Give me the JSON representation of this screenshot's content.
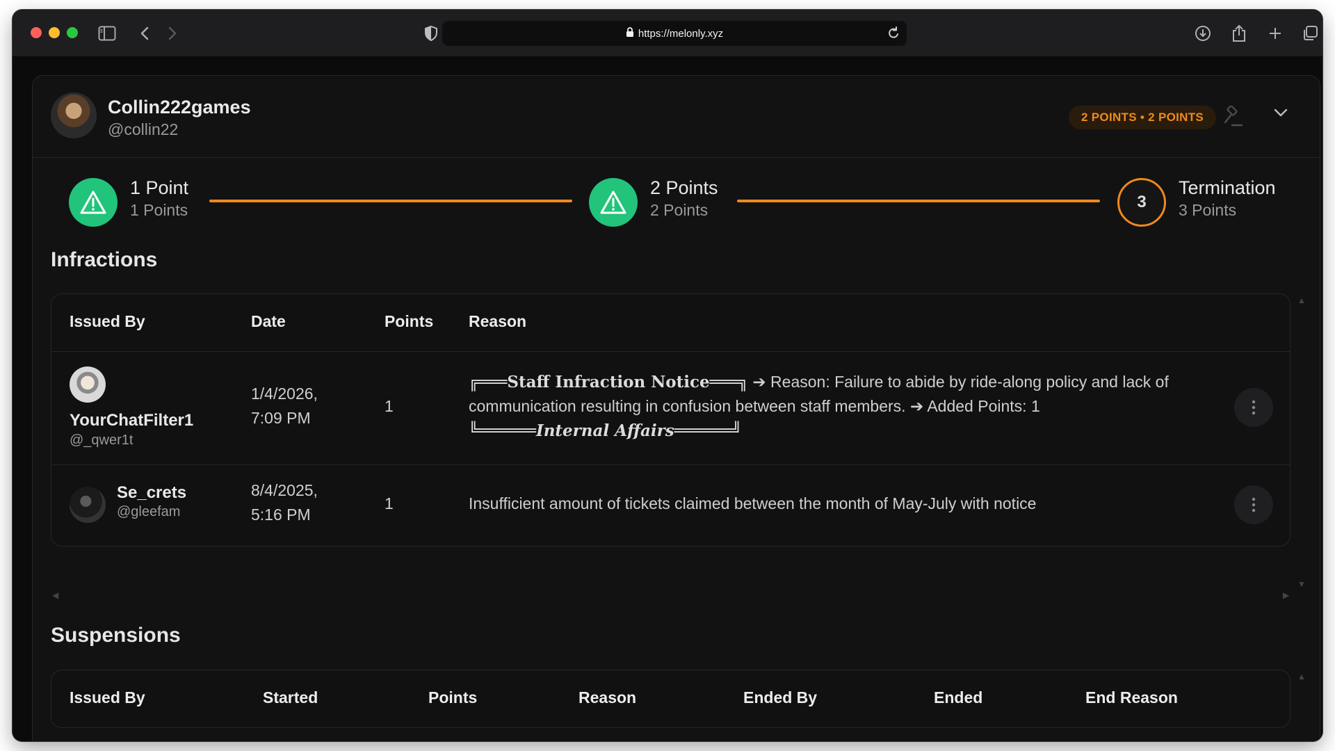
{
  "browser": {
    "url": "https://melonly.xyz"
  },
  "profile": {
    "display_name": "Collin222games",
    "handle": "@collin22",
    "points_badge": "2 POINTS • 2 POINTS"
  },
  "progress": {
    "steps": [
      {
        "title": "1 Point",
        "sub": "1 Points",
        "state": "reached",
        "icon": "warning-icon"
      },
      {
        "title": "2 Points",
        "sub": "2 Points",
        "state": "reached",
        "icon": "warning-icon"
      },
      {
        "title": "Termination",
        "sub": "3 Points",
        "state": "pending",
        "number": "3"
      }
    ]
  },
  "infractions": {
    "title": "Infractions",
    "headers": [
      "Issued By",
      "Date",
      "Points",
      "Reason"
    ],
    "rows": [
      {
        "issuer_name": "YourChatFilter1",
        "issuer_handle": "@_qwer1t",
        "date_line1": "1/4/2026,",
        "date_line2": "7:09 PM",
        "points": "1",
        "reason_header_prefix": "╔═══",
        "reason_header": "Staff Infraction Notice",
        "reason_header_suffix": "═══╗",
        "reason_text1": " ➔ Reason: Failure to abide by ride-along policy and lack of",
        "reason_text2": "communication resulting in confusion between staff members. ➔ Added Points: 1",
        "reason_footer_prefix": "╚══════",
        "reason_footer": "Internal Affairs",
        "reason_footer_suffix": "══════╝"
      },
      {
        "issuer_name": "Se_crets",
        "issuer_handle": "@gleefam",
        "date_line1": "8/4/2025,",
        "date_line2": "5:16 PM",
        "points": "1",
        "reason": "Insufficient amount of tickets claimed between the month of May-July with notice"
      }
    ]
  },
  "suspensions": {
    "title": "Suspensions",
    "headers": [
      "Issued By",
      "Started",
      "Points",
      "Reason",
      "Ended By",
      "Ended",
      "End Reason"
    ]
  },
  "colors": {
    "accent": "#f0881c",
    "success": "#21c47a",
    "background": "#0b0b0c"
  }
}
